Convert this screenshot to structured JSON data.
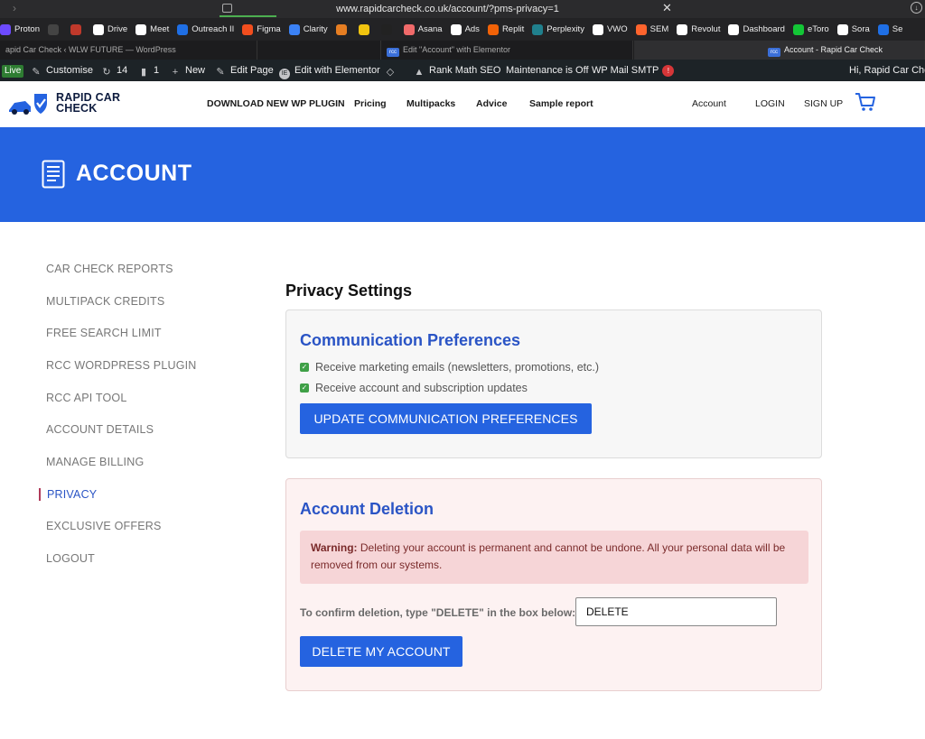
{
  "browser": {
    "url": "www.rapidcarcheck.co.uk/account/?pms-privacy=1",
    "bookmarks": [
      {
        "label": "Proton",
        "icon": "proton-icon",
        "color": "#6d4aff"
      },
      {
        "label": "",
        "icon": "circle-icon",
        "color": "#444444"
      },
      {
        "label": "",
        "icon": "square-icon",
        "color": "#c0392b"
      },
      {
        "label": "Drive",
        "icon": "google-icon",
        "color": "#ffffff"
      },
      {
        "label": "Meet",
        "icon": "google-icon",
        "color": "#ffffff"
      },
      {
        "label": "Outreach II",
        "icon": "outreach-icon",
        "color": "#1f6fe5"
      },
      {
        "label": "Figma",
        "icon": "figma-icon",
        "color": "#f24e1e"
      },
      {
        "label": "Clarity",
        "icon": "clarity-icon",
        "color": "#3b82f6"
      },
      {
        "label": "",
        "icon": "chart-icon",
        "color": "#e67e22"
      },
      {
        "label": "",
        "icon": "sun-icon",
        "color": "#f1c40f"
      },
      {
        "label": "",
        "icon": "amazon-icon",
        "color": "#222222"
      },
      {
        "label": "Asana",
        "icon": "asana-icon",
        "color": "#f06a6a"
      },
      {
        "label": "Ads",
        "icon": "google-icon",
        "color": "#ffffff"
      },
      {
        "label": "Replit",
        "icon": "replit-icon",
        "color": "#f26207"
      },
      {
        "label": "Perplexity",
        "icon": "perplexity-icon",
        "color": "#20808d"
      },
      {
        "label": "VWO",
        "icon": "vwo-icon",
        "color": "#ffffff"
      },
      {
        "label": "SEM",
        "icon": "sem-icon",
        "color": "#ff642d"
      },
      {
        "label": "Revolut",
        "icon": "revolut-icon",
        "color": "#ffffff"
      },
      {
        "label": "Dashboard",
        "icon": "dashboard-icon",
        "color": "#ffffff"
      },
      {
        "label": "eToro",
        "icon": "etoro-icon",
        "color": "#13c636"
      },
      {
        "label": "Sora",
        "icon": "sora-icon",
        "color": "#ffffff"
      },
      {
        "label": "Se",
        "icon": "s-icon",
        "color": "#1f6fe5"
      }
    ],
    "tabs": [
      {
        "label": "apid Car Check ‹ WLW FUTURE — WordPress",
        "active": false
      },
      {
        "label": "Edit \"Account\" with Elementor",
        "active": false
      },
      {
        "label": "Account - Rapid Car Check",
        "active": true
      }
    ]
  },
  "adminbar": {
    "live": "Live",
    "customise": "Customise",
    "updates": "14",
    "comments": "1",
    "new": "New",
    "edit_page": "Edit Page",
    "elementor": "Edit with Elementor",
    "rank_math": "Rank Math SEO",
    "maintenance": "Maintenance is Off",
    "smtp": "WP Mail SMTP",
    "smtp_badge": "!",
    "greeting": "Hi, Rapid Car Chec"
  },
  "header": {
    "logo_line1": "RAPID CAR",
    "logo_line2": "CHECK",
    "nav": [
      "DOWNLOAD NEW WP PLUGIN",
      "Pricing",
      "Multipacks",
      "Advice",
      "Sample report"
    ],
    "account": "Account",
    "login": "LOGIN",
    "signup": "SIGN UP"
  },
  "hero": {
    "title": "ACCOUNT"
  },
  "sidebar": {
    "items": [
      "CAR CHECK REPORTS",
      "MULTIPACK CREDITS",
      "FREE SEARCH LIMIT",
      "RCC WORDPRESS PLUGIN",
      "RCC API TOOL",
      "ACCOUNT DETAILS",
      "MANAGE BILLING",
      "PRIVACY",
      "EXCLUSIVE OFFERS",
      "LOGOUT"
    ],
    "active": "PRIVACY"
  },
  "main": {
    "title": "Privacy Settings",
    "communication": {
      "heading": "Communication Preferences",
      "opt1": "Receive marketing emails (newsletters, promotions, etc.)",
      "opt2": "Receive account and subscription updates",
      "button": "UPDATE COMMUNICATION PREFERENCES"
    },
    "deletion": {
      "heading": "Account Deletion",
      "warning_label": "Warning:",
      "warning_text": " Deleting your account is permanent and cannot be undone. All your personal data will be removed from our systems.",
      "confirm_label": "To confirm deletion, type \"DELETE\" in the box below:",
      "confirm_value": "DELETE",
      "button": "DELETE MY ACCOUNT"
    }
  },
  "colors": {
    "brand_blue": "#2563e0",
    "active_link": "#2a54c5",
    "warning_bg": "#f6d5d7"
  }
}
